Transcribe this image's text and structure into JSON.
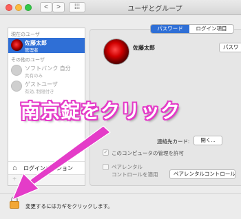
{
  "window": {
    "title": "ユーザとグループ",
    "back_glyph": "<",
    "forward_glyph": ">",
    "grid_glyph": "⁞⁞⁞"
  },
  "sidebar": {
    "current_user_section": "現在のユーザ",
    "current_user": {
      "name": "佐藤太郎",
      "role": "管理者"
    },
    "other_users_section": "その他のユーザ",
    "other_users": [
      {
        "name": "ソフトバンク 自分",
        "role": "共有のみ"
      },
      {
        "name": "ゲストユーザ",
        "role": "有効, 制限付き"
      }
    ],
    "login_options_label": "ログインオプション",
    "add_glyph": "+",
    "remove_glyph": "−"
  },
  "tabs": [
    {
      "label": "パスワード",
      "active": true
    },
    {
      "label": "ログイン項目",
      "active": false
    }
  ],
  "main": {
    "user_name": "佐藤太郎",
    "password_button": "パスワ",
    "contact_card_label": "連絡先カード:",
    "open_button": "開く...",
    "allow_admin_label": "このコンピュータの管理を許可",
    "allow_admin_checked": true,
    "check_glyph": "✓",
    "parental_label_line1": "ペアレンタル",
    "parental_label_line2": "コントロールを適用",
    "parental_checked": false,
    "parental_button": "ペアレンタルコントロール..."
  },
  "bottom": {
    "lock_label": "変更するにはカギをクリックします。"
  },
  "annotation": {
    "text": "南京錠をクリック",
    "color": "#e43cc8"
  },
  "colors": {
    "accent": "#2f6fd6",
    "lock": "#f2a736"
  }
}
